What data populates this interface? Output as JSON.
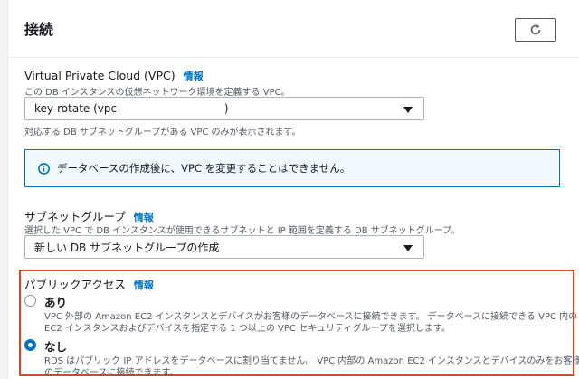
{
  "section": {
    "title": "接続"
  },
  "vpc": {
    "label": "Virtual Private Cloud (VPC)",
    "info": "情報",
    "description": "この DB インスタンスの仮想ネットワーク環境を定義する VPC。",
    "selected": "key-rotate (vpc-                              )",
    "hint": "対応する DB サブネットグループがある VPC のみが表示されます。"
  },
  "alert": {
    "icon": "info-circle-icon",
    "text": "データベースの作成後に、VPC を変更することはできません。"
  },
  "subnet": {
    "label": "サブネットグループ",
    "info": "情報",
    "description": "選択した VPC で DB インスタンスが使用できるサブネットと IP 範囲を定義する DB サブネットグループ。",
    "selected": "新しい DB サブネットグループの作成"
  },
  "public_access": {
    "label": "パブリックアクセス",
    "info": "情報",
    "options": [
      {
        "label": "あり",
        "checked": false,
        "desc1": "VPC 外部の Amazon EC2 インスタンスとデバイスがお客様のデータベースに接続できます。 データベースに接続できる VPC 内の",
        "desc2": "EC2 インスタンスおよびデバイスを指定する 1 つ以上の VPC セキュリティグループを選択します。"
      },
      {
        "label": "なし",
        "checked": true,
        "desc1": "RDS はパブリック IP アドレスをデータベースに割り当てません。 VPC 内部の Amazon EC2 インスタンスとデバイスのみをお客様",
        "desc2": "のデータベースに接続できます。"
      }
    ]
  },
  "colors": {
    "accent": "#0073bb",
    "highlight_border": "#e0431f",
    "alert_bg": "#f1faff"
  }
}
